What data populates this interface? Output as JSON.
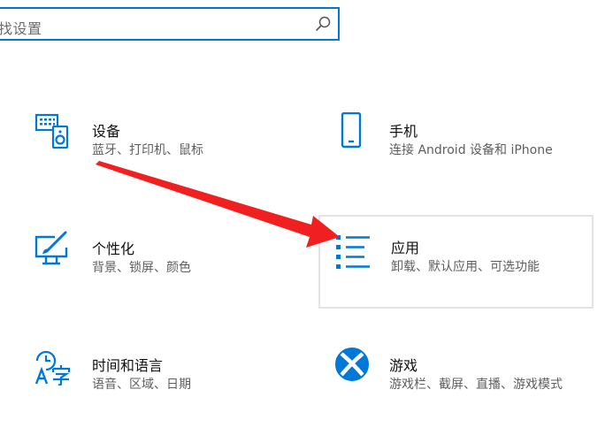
{
  "search": {
    "placeholder": "找设置"
  },
  "settings": {
    "devices": {
      "title": "设备",
      "desc": "蓝牙、打印机、鼠标",
      "icon": "devices-icon"
    },
    "phone": {
      "title": "手机",
      "desc": "连接 Android 设备和 iPhone",
      "icon": "phone-icon"
    },
    "personalization": {
      "title": "个性化",
      "desc": "背景、锁屏、颜色",
      "icon": "personalization-icon"
    },
    "apps": {
      "title": "应用",
      "desc": "卸载、默认应用、可选功能",
      "icon": "apps-icon"
    },
    "time_language": {
      "title": "时间和语言",
      "desc": "语音、区域、日期",
      "icon": "time-language-icon"
    },
    "gaming": {
      "title": "游戏",
      "desc": "游戏栏、截屏、直播、游戏模式",
      "icon": "xbox-icon"
    }
  },
  "colors": {
    "accent": "#0078d7",
    "annotation_arrow": "#f02020"
  }
}
